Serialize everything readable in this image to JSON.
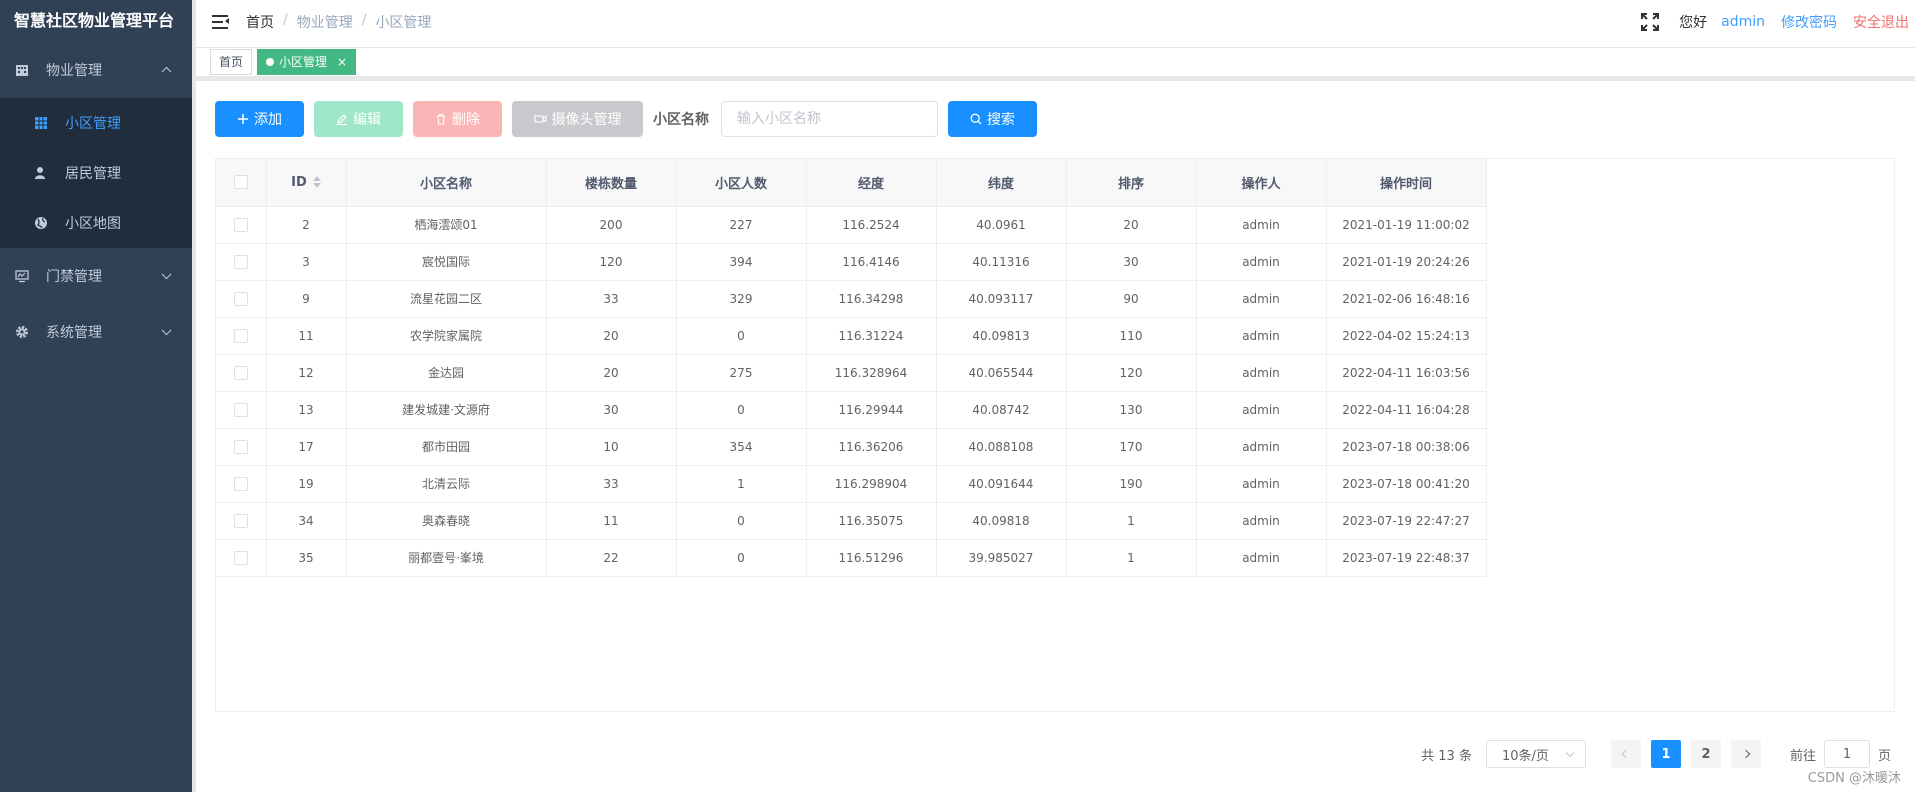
{
  "app": {
    "title": "智慧社区物业管理平台"
  },
  "sidebar": {
    "menus": [
      {
        "label": "物业管理",
        "expanded": true,
        "icon": "building-icon",
        "children": [
          {
            "label": "小区管理",
            "active": true,
            "icon": "grid-icon"
          },
          {
            "label": "居民管理",
            "active": false,
            "icon": "user-icon"
          },
          {
            "label": "小区地图",
            "active": false,
            "icon": "globe-icon"
          }
        ]
      },
      {
        "label": "门禁管理",
        "expanded": false,
        "icon": "monitor-icon"
      },
      {
        "label": "系统管理",
        "expanded": false,
        "icon": "gear-icon"
      }
    ]
  },
  "header": {
    "breadcrumb": [
      "首页",
      "物业管理",
      "小区管理"
    ],
    "greeting": "您好",
    "username": "admin",
    "change_password": "修改密码",
    "logout": "安全退出"
  },
  "tags": [
    {
      "label": "首页",
      "active": false
    },
    {
      "label": "小区管理",
      "active": true
    }
  ],
  "toolbar": {
    "add": "添加",
    "edit": "编辑",
    "delete": "删除",
    "camera": "摄像头管理",
    "search_label": "小区名称",
    "search_placeholder": "输入小区名称",
    "search_value": "",
    "search_button": "搜索"
  },
  "table": {
    "columns": [
      "ID",
      "小区名称",
      "楼栋数量",
      "小区人数",
      "经度",
      "纬度",
      "排序",
      "操作人",
      "操作时间"
    ],
    "rows": [
      [
        "2",
        "栖海澐颂01",
        "200",
        "227",
        "116.2524",
        "40.0961",
        "20",
        "admin",
        "2021-01-19 11:00:02"
      ],
      [
        "3",
        "宸悦国际",
        "120",
        "394",
        "116.4146",
        "40.11316",
        "30",
        "admin",
        "2021-01-19 20:24:26"
      ],
      [
        "9",
        "流星花园二区",
        "33",
        "329",
        "116.34298",
        "40.093117",
        "90",
        "admin",
        "2021-02-06 16:48:16"
      ],
      [
        "11",
        "农学院家属院",
        "20",
        "0",
        "116.31224",
        "40.09813",
        "110",
        "admin",
        "2022-04-02 15:24:13"
      ],
      [
        "12",
        "金达园",
        "20",
        "275",
        "116.328964",
        "40.065544",
        "120",
        "admin",
        "2022-04-11 16:03:56"
      ],
      [
        "13",
        "建发城建·文源府",
        "30",
        "0",
        "116.29944",
        "40.08742",
        "130",
        "admin",
        "2022-04-11 16:04:28"
      ],
      [
        "17",
        "都市田园",
        "10",
        "354",
        "116.36206",
        "40.088108",
        "170",
        "admin",
        "2023-07-18 00:38:06"
      ],
      [
        "19",
        "北清云际",
        "33",
        "1",
        "116.298904",
        "40.091644",
        "190",
        "admin",
        "2023-07-18 00:41:20"
      ],
      [
        "34",
        "奥森春晓",
        "11",
        "0",
        "116.35075",
        "40.09818",
        "1",
        "admin",
        "2023-07-19 22:47:27"
      ],
      [
        "35",
        "丽都壹号·峯境",
        "22",
        "0",
        "116.51296",
        "39.985027",
        "1",
        "admin",
        "2023-07-19 22:48:37"
      ]
    ]
  },
  "pagination": {
    "total_text": "共 13 条",
    "page_size": "10条/页",
    "pages": [
      "1",
      "2"
    ],
    "current_page": "1",
    "goto_prefix": "前往",
    "goto_value": "1",
    "goto_suffix": "页"
  },
  "watermark": "CSDN @沐暖沐",
  "colors": {
    "sidebar_bg": "#304156",
    "primary": "#1890ff",
    "tag_active": "#42b983",
    "danger": "#f56c6c"
  }
}
